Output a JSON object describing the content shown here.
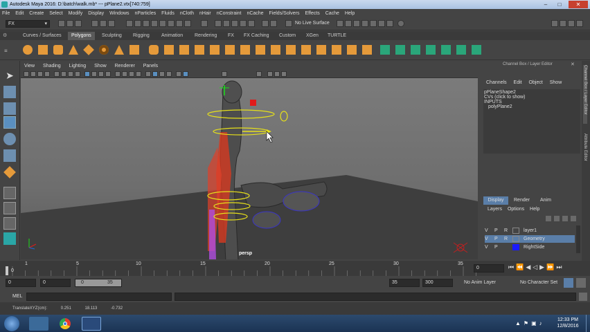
{
  "window": {
    "title": "Autodesk Maya 2016: D:\\batch\\walk.mb*  ---  pPlane2.vtx[740:759]"
  },
  "menubar": [
    "File",
    "Edit",
    "Create",
    "Select",
    "Modify",
    "Display",
    "Windows",
    "nParticles",
    "Fluids",
    "nCloth",
    "nHair",
    "nConstraint",
    "nCache",
    "Fields/Solvers",
    "Effects",
    "Cache",
    "Help"
  ],
  "statusline": {
    "mode": "FX",
    "live_surface": "No Live Surface"
  },
  "shelf_tabs": [
    "Curves / Surfaces",
    "Polygons",
    "Sculpting",
    "Rigging",
    "Animation",
    "Rendering",
    "FX",
    "FX Caching",
    "Custom",
    "XGen",
    "TURTLE"
  ],
  "shelf_active": "Polygons",
  "viewport": {
    "menu": [
      "View",
      "Shading",
      "Lighting",
      "Show",
      "Renderer",
      "Panels"
    ],
    "camera_label": "persp"
  },
  "channel_box": {
    "header": "Channel Box / Layer Editor",
    "menu": [
      "Channels",
      "Edit",
      "Object",
      "Show"
    ],
    "object": "pPlaneShape2",
    "cvs": "CVs (click to show)",
    "inputs_label": "INPUTS",
    "input_node": "polyPlane2"
  },
  "side_tabs": [
    "Channel Box / Layer Editor",
    "Attribute Editor"
  ],
  "layer_editor": {
    "tabs": [
      "Display",
      "Render",
      "Anim"
    ],
    "menu": [
      "Layers",
      "Options",
      "Help"
    ],
    "layers": [
      {
        "v": "V",
        "p": "P",
        "r": "R",
        "name": "layer1",
        "color": "#444444",
        "selected": false
      },
      {
        "v": "V",
        "p": "P",
        "r": "R",
        "name": "Geometry",
        "color": "#444444",
        "selected": true
      },
      {
        "v": "V",
        "p": "P",
        "r": "",
        "name": "RightSide",
        "color": "#1a1aff",
        "selected": false
      }
    ]
  },
  "timeline": {
    "ticks": [
      "0",
      "1",
      "5",
      "10",
      "15",
      "20",
      "25",
      "30",
      "35"
    ],
    "current_frame": "0"
  },
  "range": {
    "start": "0",
    "playback_start": "0",
    "slider_start": "0",
    "slider_end": "35",
    "playback_end": "35",
    "end": "300",
    "anim_layer": "No Anim Layer",
    "char_set": "No Character Set"
  },
  "cmdline": {
    "label": "MEL"
  },
  "helpline": {
    "label": "TranslateXYZ(cm):",
    "x": "0.251",
    "y": "18.113",
    "z": "-0.732"
  },
  "taskbar": {
    "time": "12:33 PM",
    "date": "12/8/2016"
  }
}
